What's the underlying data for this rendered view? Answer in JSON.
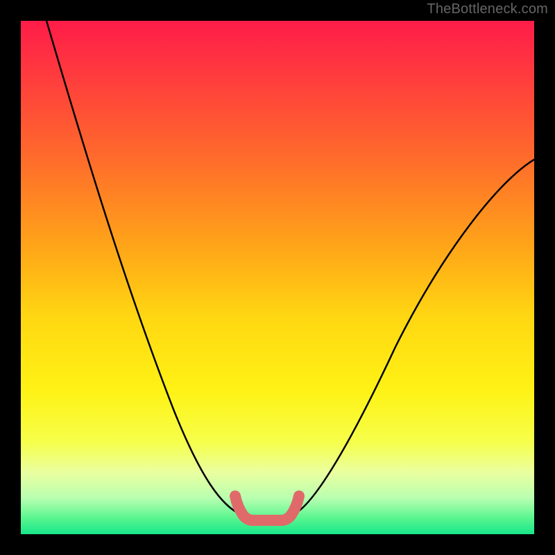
{
  "watermark": "TheBottleneck.com",
  "chart_data": {
    "type": "line",
    "title": "",
    "xlabel": "",
    "ylabel": "",
    "xlim": [
      0,
      100
    ],
    "ylim": [
      0,
      100
    ],
    "series": [
      {
        "name": "bottleneck-curve",
        "x": [
          5,
          10,
          15,
          20,
          25,
          30,
          35,
          40,
          43,
          46,
          50,
          54,
          57,
          62,
          70,
          80,
          90,
          100
        ],
        "values": [
          100,
          83,
          68,
          55,
          42,
          31,
          21,
          12,
          7,
          4,
          3,
          4,
          7,
          15,
          27,
          42,
          55,
          66
        ]
      }
    ],
    "annotations": [
      {
        "name": "minimum-marker",
        "x_range": [
          43,
          57
        ],
        "y": 4
      }
    ],
    "gradient_stops": [
      {
        "pos": 0,
        "color": "#ff1c49"
      },
      {
        "pos": 72,
        "color": "#fff215"
      },
      {
        "pos": 100,
        "color": "#17e68a"
      }
    ]
  }
}
